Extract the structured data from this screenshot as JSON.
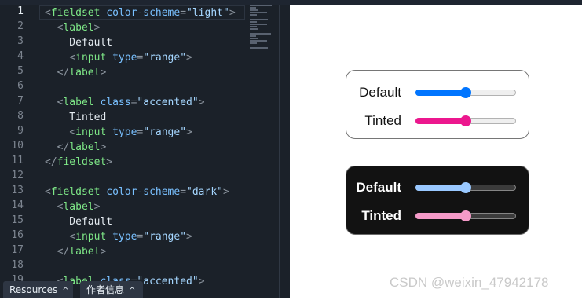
{
  "editor": {
    "active_line": 1,
    "line_numbers": [
      "1",
      "2",
      "3",
      "4",
      "5",
      "6",
      "7",
      "8",
      "9",
      "10",
      "11",
      "12",
      "13",
      "14",
      "15",
      "16",
      "17",
      "18",
      "19"
    ],
    "lines": [
      [
        {
          "c": "bracket",
          "t": "<"
        },
        {
          "c": "tag",
          "t": "fieldset"
        },
        {
          "c": "txt",
          "t": " "
        },
        {
          "c": "attr",
          "t": "color-scheme"
        },
        {
          "c": "bracket",
          "t": "="
        },
        {
          "c": "str",
          "t": "\"light\""
        },
        {
          "c": "bracket",
          "t": ">"
        }
      ],
      [
        {
          "c": "txt",
          "t": "  "
        },
        {
          "c": "bracket",
          "t": "<"
        },
        {
          "c": "tag",
          "t": "label"
        },
        {
          "c": "bracket",
          "t": ">"
        }
      ],
      [
        {
          "c": "txt",
          "t": "    Default"
        }
      ],
      [
        {
          "c": "txt",
          "t": "    "
        },
        {
          "c": "bracket",
          "t": "<"
        },
        {
          "c": "tag",
          "t": "input"
        },
        {
          "c": "txt",
          "t": " "
        },
        {
          "c": "attr",
          "t": "type"
        },
        {
          "c": "bracket",
          "t": "="
        },
        {
          "c": "str",
          "t": "\"range\""
        },
        {
          "c": "bracket",
          "t": ">"
        }
      ],
      [
        {
          "c": "txt",
          "t": "  "
        },
        {
          "c": "bracket",
          "t": "</"
        },
        {
          "c": "tag",
          "t": "label"
        },
        {
          "c": "bracket",
          "t": ">"
        }
      ],
      [],
      [
        {
          "c": "txt",
          "t": "  "
        },
        {
          "c": "bracket",
          "t": "<"
        },
        {
          "c": "tag",
          "t": "label"
        },
        {
          "c": "txt",
          "t": " "
        },
        {
          "c": "attr",
          "t": "class"
        },
        {
          "c": "bracket",
          "t": "="
        },
        {
          "c": "str",
          "t": "\"accented\""
        },
        {
          "c": "bracket",
          "t": ">"
        }
      ],
      [
        {
          "c": "txt",
          "t": "    Tinted"
        }
      ],
      [
        {
          "c": "txt",
          "t": "    "
        },
        {
          "c": "bracket",
          "t": "<"
        },
        {
          "c": "tag",
          "t": "input"
        },
        {
          "c": "txt",
          "t": " "
        },
        {
          "c": "attr",
          "t": "type"
        },
        {
          "c": "bracket",
          "t": "="
        },
        {
          "c": "str",
          "t": "\"range\""
        },
        {
          "c": "bracket",
          "t": ">"
        }
      ],
      [
        {
          "c": "txt",
          "t": "  "
        },
        {
          "c": "bracket",
          "t": "</"
        },
        {
          "c": "tag",
          "t": "label"
        },
        {
          "c": "bracket",
          "t": ">"
        }
      ],
      [
        {
          "c": "bracket",
          "t": "</"
        },
        {
          "c": "tag",
          "t": "fieldset"
        },
        {
          "c": "bracket",
          "t": ">"
        }
      ],
      [],
      [
        {
          "c": "bracket",
          "t": "<"
        },
        {
          "c": "tag",
          "t": "fieldset"
        },
        {
          "c": "txt",
          "t": " "
        },
        {
          "c": "attr",
          "t": "color-scheme"
        },
        {
          "c": "bracket",
          "t": "="
        },
        {
          "c": "str",
          "t": "\"dark\""
        },
        {
          "c": "bracket",
          "t": ">"
        }
      ],
      [
        {
          "c": "txt",
          "t": "  "
        },
        {
          "c": "bracket",
          "t": "<"
        },
        {
          "c": "tag",
          "t": "label"
        },
        {
          "c": "bracket",
          "t": ">"
        }
      ],
      [
        {
          "c": "txt",
          "t": "    Default"
        }
      ],
      [
        {
          "c": "txt",
          "t": "    "
        },
        {
          "c": "bracket",
          "t": "<"
        },
        {
          "c": "tag",
          "t": "input"
        },
        {
          "c": "txt",
          "t": " "
        },
        {
          "c": "attr",
          "t": "type"
        },
        {
          "c": "bracket",
          "t": "="
        },
        {
          "c": "str",
          "t": "\"range\""
        },
        {
          "c": "bracket",
          "t": ">"
        }
      ],
      [
        {
          "c": "txt",
          "t": "  "
        },
        {
          "c": "bracket",
          "t": "</"
        },
        {
          "c": "tag",
          "t": "label"
        },
        {
          "c": "bracket",
          "t": ">"
        }
      ],
      [],
      [
        {
          "c": "txt",
          "t": "  "
        },
        {
          "c": "bracket",
          "t": "<"
        },
        {
          "c": "tag",
          "t": "label"
        },
        {
          "c": "txt",
          "t": " "
        },
        {
          "c": "attr",
          "t": "class"
        },
        {
          "c": "bracket",
          "t": "="
        },
        {
          "c": "str",
          "t": "\"accented\""
        },
        {
          "c": "bracket",
          "t": ">"
        }
      ]
    ]
  },
  "footer": {
    "resources_label": "Resources",
    "author_label": "作者信息",
    "chevron_icon": "chevron-up-icon"
  },
  "preview": {
    "light": {
      "rows": [
        {
          "label": "Default",
          "value": 0.5,
          "fill_color": "#0075ff"
        },
        {
          "label": "Tinted",
          "value": 0.5,
          "fill_color": "#ec178e"
        }
      ]
    },
    "dark": {
      "rows": [
        {
          "label": "Default",
          "value": 0.5,
          "fill_color": "#99c8ff"
        },
        {
          "label": "Tinted",
          "value": 0.5,
          "fill_color": "#f59ac8"
        }
      ]
    }
  },
  "watermark": "CSDN @weixin_47942178"
}
